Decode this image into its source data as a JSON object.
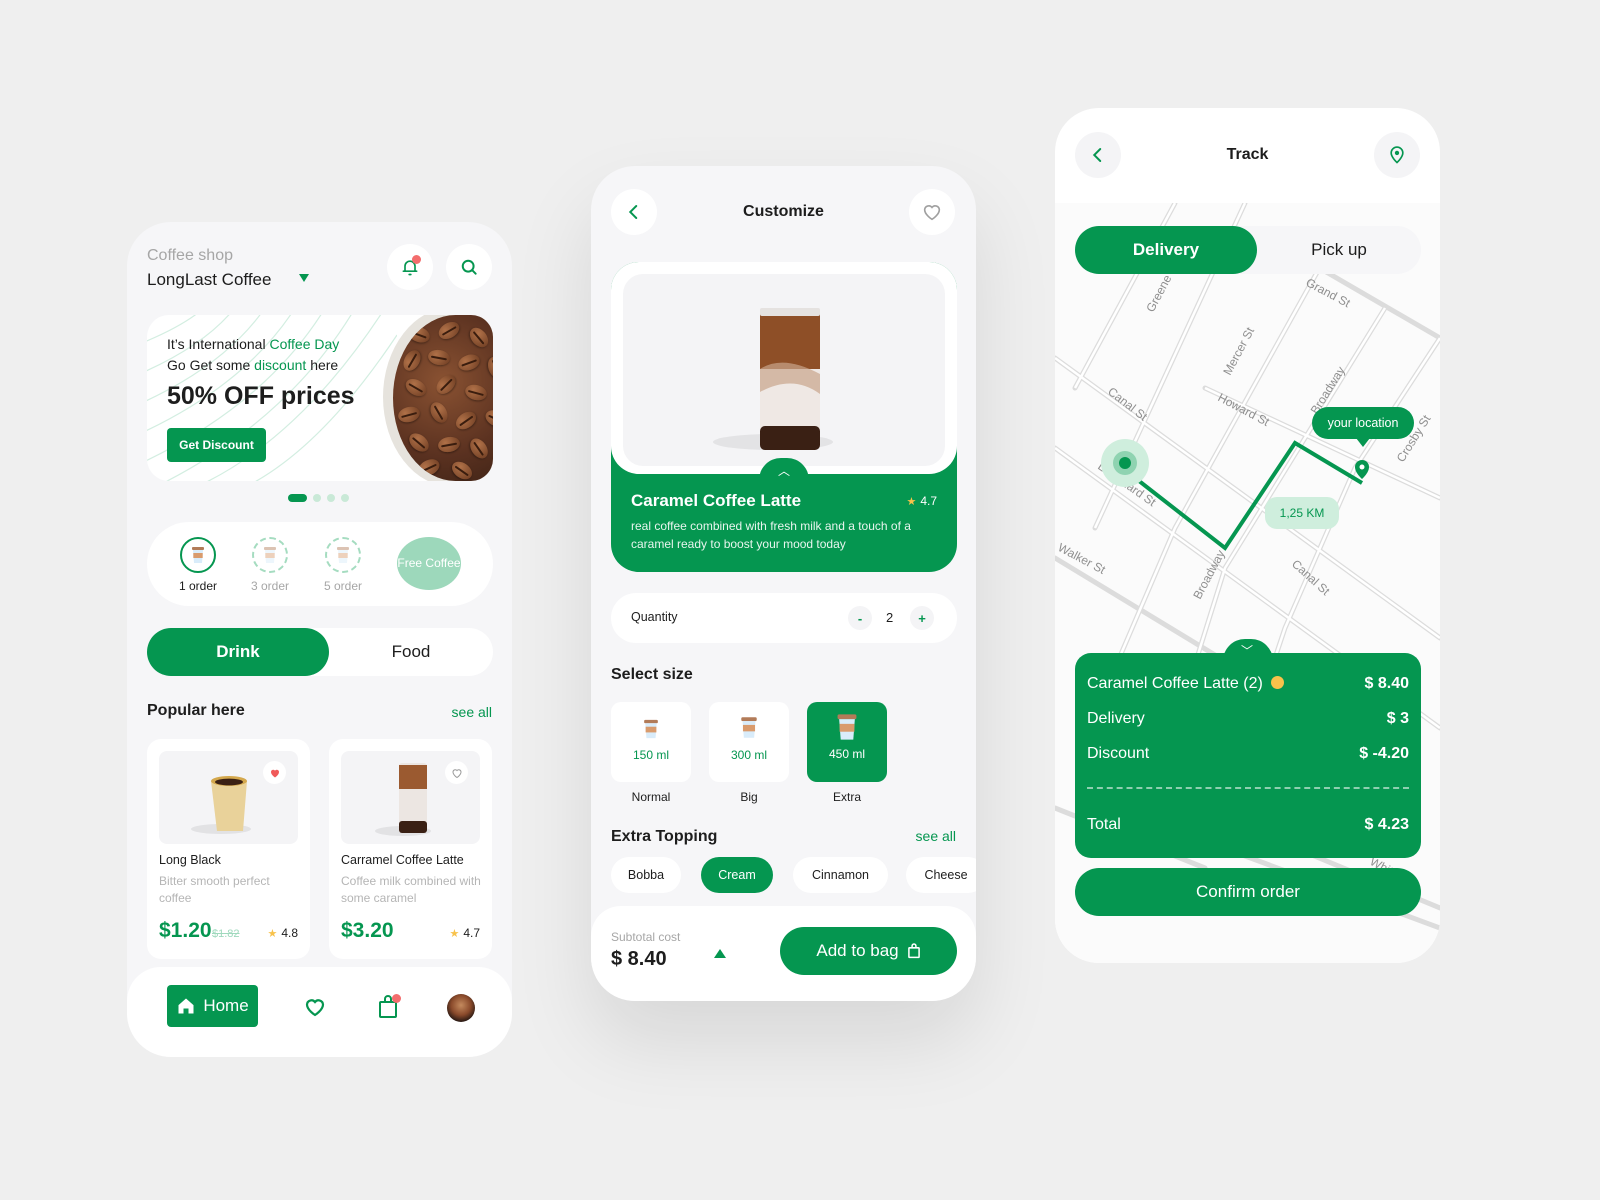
{
  "theme": {
    "accent": "#059650",
    "accent_light": "#cfeedd",
    "alert": "#f36d6d",
    "star": "#f8c24b",
    "background": "#efefef"
  },
  "home": {
    "shop_label": "Coffee shop",
    "shop_name": "LongLast Coffee",
    "icons": {
      "notification": "bell-icon",
      "search": "search-icon"
    },
    "banner": {
      "line1_prefix": "It’s International ",
      "line1_highlight": "Coffee Day",
      "line2_prefix": "Go Get some ",
      "line2_highlight": "discount",
      "line2_suffix": " here",
      "headline": "50% OFF prices",
      "cta": "Get Discount",
      "carousel_pages": 4,
      "carousel_active": 1
    },
    "loyalty": [
      {
        "label": "1 order",
        "status": "done"
      },
      {
        "label": "3 order",
        "status": "pending"
      },
      {
        "label": "5 order",
        "status": "pending"
      }
    ],
    "loyalty_reward": "Free Coffee",
    "tabs": [
      {
        "label": "Drink",
        "active": true
      },
      {
        "label": "Food",
        "active": false
      }
    ],
    "popular_title": "Popular here",
    "see_all": "see all",
    "products": [
      {
        "name": "Long Black",
        "desc": "Bitter smooth perfect coffee",
        "price": "$1.20",
        "old_price": "$1.82",
        "rating": "4.8",
        "favorite": true
      },
      {
        "name": "Carramel Coffee Latte",
        "desc": "Coffee milk combined with some caramel",
        "price": "$3.20",
        "old_price": "",
        "rating": "4.7",
        "favorite": false
      }
    ],
    "nav": {
      "home": "Home",
      "favorites": "heart-icon",
      "bag": "bag-icon",
      "profile": "avatar"
    }
  },
  "customize": {
    "title": "Customize",
    "product": {
      "name": "Caramel Coffee Latte",
      "rating": "4.7",
      "desc": "real coffee combined with fresh milk and a touch of a caramel ready to boost your mood today"
    },
    "quantity_label": "Quantity",
    "quantity": "2",
    "minus": "-",
    "plus": "+",
    "size_title": "Select size",
    "sizes": [
      {
        "ml": "150 ml",
        "label": "Normal",
        "selected": false
      },
      {
        "ml": "300 ml",
        "label": "Big",
        "selected": false
      },
      {
        "ml": "450 ml",
        "label": "Extra",
        "selected": true
      }
    ],
    "topping_title": "Extra Topping",
    "see_all": "see all",
    "toppings": [
      {
        "label": "Bobba",
        "selected": false
      },
      {
        "label": "Cream",
        "selected": true
      },
      {
        "label": "Cinnamon",
        "selected": false
      },
      {
        "label": "Cheese",
        "selected": false
      }
    ],
    "subtotal_label": "Subtotal cost",
    "subtotal": "$ 8.40",
    "add_to_bag": "Add to bag"
  },
  "track": {
    "title": "Track",
    "tabs": [
      {
        "label": "Delivery",
        "active": true
      },
      {
        "label": "Pick up",
        "active": false
      }
    ],
    "map": {
      "streets": [
        "Greene St",
        "Mercer St",
        "Grand St",
        "Broadway",
        "Canal St",
        "Howard St",
        "Lispenard St",
        "Walker St",
        "Crosby St",
        "White St"
      ],
      "your_location": "your location",
      "distance": "1,25 KM"
    },
    "receipt": [
      {
        "label": "Caramel Coffee Latte (2)",
        "amount": "$ 8.40",
        "info": true
      },
      {
        "label": "Delivery",
        "amount": "$ 3"
      },
      {
        "label": "Discount",
        "amount": "$ -4.20"
      }
    ],
    "total_label": "Total",
    "total": "$ 4.23",
    "confirm": "Confirm order"
  }
}
